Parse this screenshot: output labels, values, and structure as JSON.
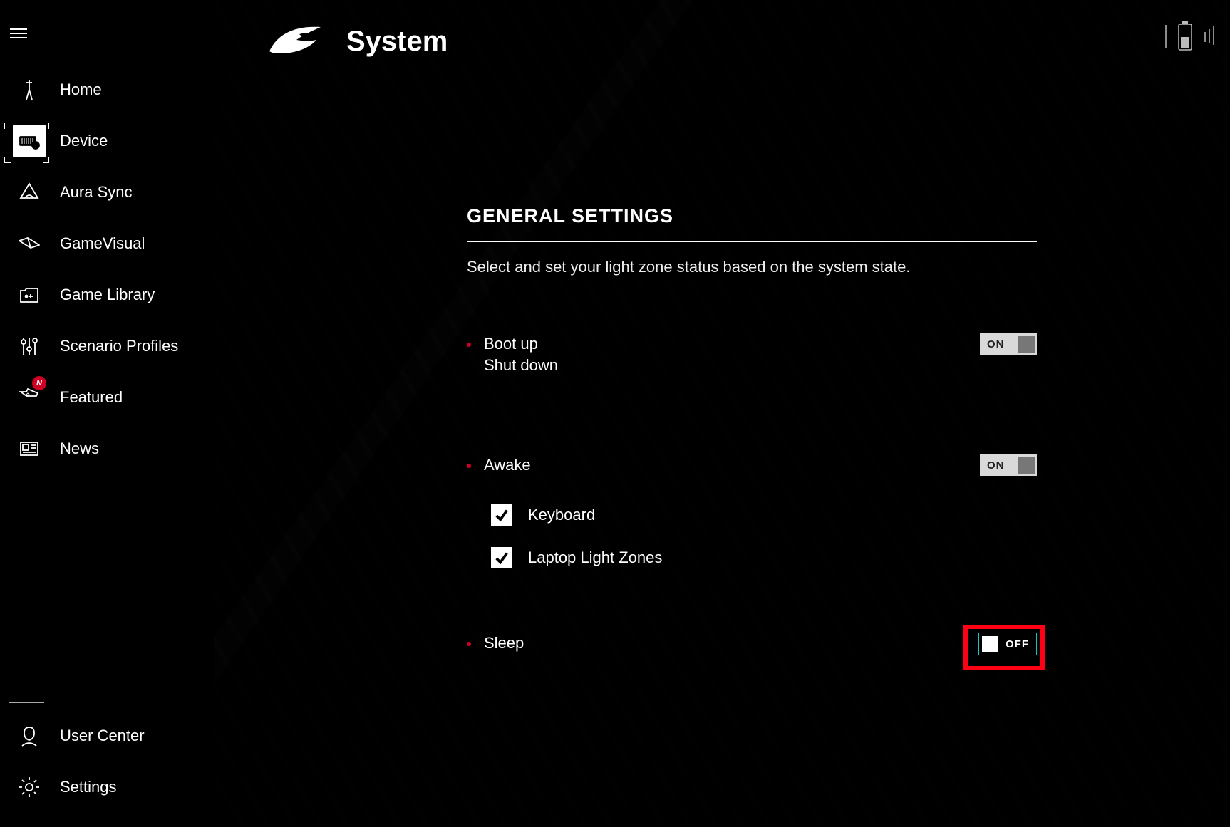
{
  "page_title": "System",
  "sidebar": {
    "items": [
      {
        "label": "Home"
      },
      {
        "label": "Device"
      },
      {
        "label": "Aura Sync"
      },
      {
        "label": "GameVisual"
      },
      {
        "label": "Game Library"
      },
      {
        "label": "Scenario Profiles"
      },
      {
        "label": "Featured",
        "badge": "N"
      },
      {
        "label": "News"
      }
    ],
    "bottom": [
      {
        "label": "User Center"
      },
      {
        "label": "Settings"
      }
    ]
  },
  "section": {
    "title": "GENERAL SETTINGS",
    "description": "Select and set your light zone status based on the system state."
  },
  "settings": {
    "boot": {
      "line1": "Boot up",
      "line2": "Shut down",
      "toggle_label": "ON"
    },
    "awake": {
      "label": "Awake",
      "toggle_label": "ON",
      "sub1": "Keyboard",
      "sub2": "Laptop Light Zones"
    },
    "sleep": {
      "label": "Sleep",
      "toggle_label": "OFF"
    }
  }
}
